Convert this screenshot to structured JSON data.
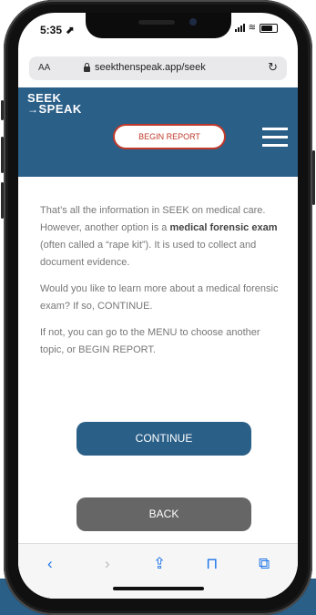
{
  "status_bar": {
    "time": "5:35 ⬈"
  },
  "browser": {
    "text_size_label": "AA",
    "url": "seekthenspeak.app/seek",
    "reload_icon": "reload-icon"
  },
  "header": {
    "logo_line1": "SEEK",
    "logo_arrow": "→",
    "logo_line2": "SPEAK",
    "begin_report_label": "BEGIN REPORT",
    "brand_color": "#2a5f88",
    "accent_color": "#c0392b"
  },
  "content": {
    "p1_before": "That’s all the information in SEEK on medical care. However, another option is a ",
    "p1_bold": "medical forensic exam",
    "p1_after": " (often called a “rape kit”). It is used to collect and document evidence.",
    "p2": "Would you like to learn more about a medical forensic exam? If so, CONTINUE.",
    "p3": "If not, you can go to the MENU to choose another topic, or BEGIN REPORT."
  },
  "actions": {
    "continue_label": "CONTINUE",
    "back_label": "BACK"
  },
  "toolbar": {
    "back_glyph": "‹",
    "forward_glyph": "›",
    "share_glyph": "⇪",
    "bookmarks_glyph": "⊓",
    "tabs_glyph": "⧉"
  }
}
